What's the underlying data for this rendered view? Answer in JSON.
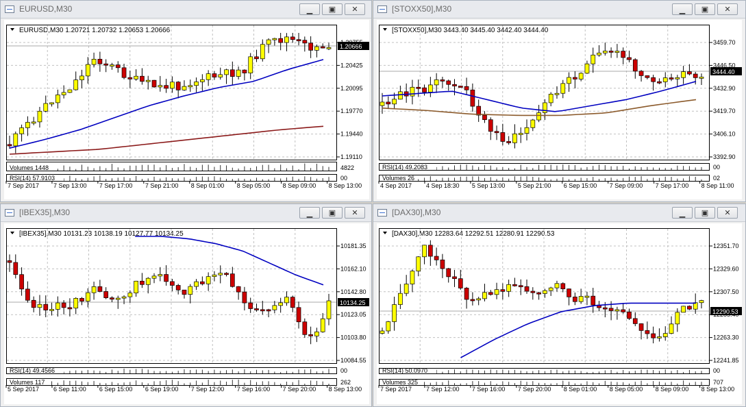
{
  "windows": [
    {
      "title": "EURUSD,M30",
      "info": "EURUSD,M30  1.20721 1.20732 1.20653 1.20666",
      "price_labels": [
        "1.20755",
        "1.20425",
        "1.20095",
        "1.19770",
        "1.19440",
        "1.19110"
      ],
      "current_price": "1.20666",
      "time_labels": [
        "7 Sep 2017",
        "7 Sep 13:00",
        "7 Sep 17:00",
        "7 Sep 21:00",
        "8 Sep 01:00",
        "8 Sep 05:00",
        "8 Sep 09:00",
        "8 Sep 13:00"
      ],
      "sub1_label": "Volumes 1448",
      "sub1_value": "4822",
      "sub2_label": "RSI(14) 57.9103",
      "sub2_value": "00"
    },
    {
      "title": "[STOXX50],M30",
      "info": "[STOXX50],M30  3443.40 3445.40 3442.40 3444.40",
      "price_labels": [
        "3459.70",
        "3446.50",
        "3432.90",
        "3419.70",
        "3406.10",
        "3392.90"
      ],
      "current_price": "3444.40",
      "time_labels": [
        "4 Sep 2017",
        "4 Sep 18:30",
        "5 Sep 13:00",
        "5 Sep 21:00",
        "6 Sep 15:00",
        "7 Sep 09:00",
        "7 Sep 17:00",
        "8 Sep 11:00"
      ],
      "sub1_label": "RSI(14) 49.2083",
      "sub1_value": "00",
      "sub2_label": "Volumes 26",
      "sub2_value": "02"
    },
    {
      "title": "[IBEX35],M30",
      "info": "[IBEX35],M30  10131.23 10138.19 10127.77 10134.25",
      "price_labels": [
        "10181.35",
        "10162.10",
        "10142.80",
        "10123.05",
        "10103.80",
        "10084.55"
      ],
      "current_price": "10134.25",
      "time_labels": [
        "5 Sep 2017",
        "6 Sep 11:00",
        "6 Sep 15:00",
        "6 Sep 19:00",
        "7 Sep 12:00",
        "7 Sep 16:00",
        "7 Sep 20:00",
        "8 Sep 13:00"
      ],
      "sub1_label": "RSI(14) 49.4566",
      "sub1_value": "00",
      "sub2_label": "Volumes 117",
      "sub2_value": "262"
    },
    {
      "title": "[DAX30],M30",
      "info": "[DAX30],M30  12283.64 12292.51 12280.91 12290.53",
      "price_labels": [
        "12351.70",
        "12329.60",
        "12307.50",
        "12285.40",
        "12263.30",
        "12241.85"
      ],
      "current_price": "12290.53",
      "time_labels": [
        "7 Sep 2017",
        "7 Sep 12:00",
        "7 Sep 16:00",
        "7 Sep 20:00",
        "8 Sep 01:00",
        "8 Sep 05:00",
        "8 Sep 09:00",
        "8 Sep 13:00"
      ],
      "sub1_label": "RSI(14) 50.0970",
      "sub1_value": "00",
      "sub2_label": "Volumes 325",
      "sub2_value": "707"
    }
  ],
  "colors": {
    "up": "#ffff00",
    "down": "#cc0000",
    "ma_fast": "#0000c0",
    "ma_slow": "#8b1a1a",
    "ma_slow_stoxx": "#8b5a2b",
    "grid": "#c0c0c0"
  }
}
